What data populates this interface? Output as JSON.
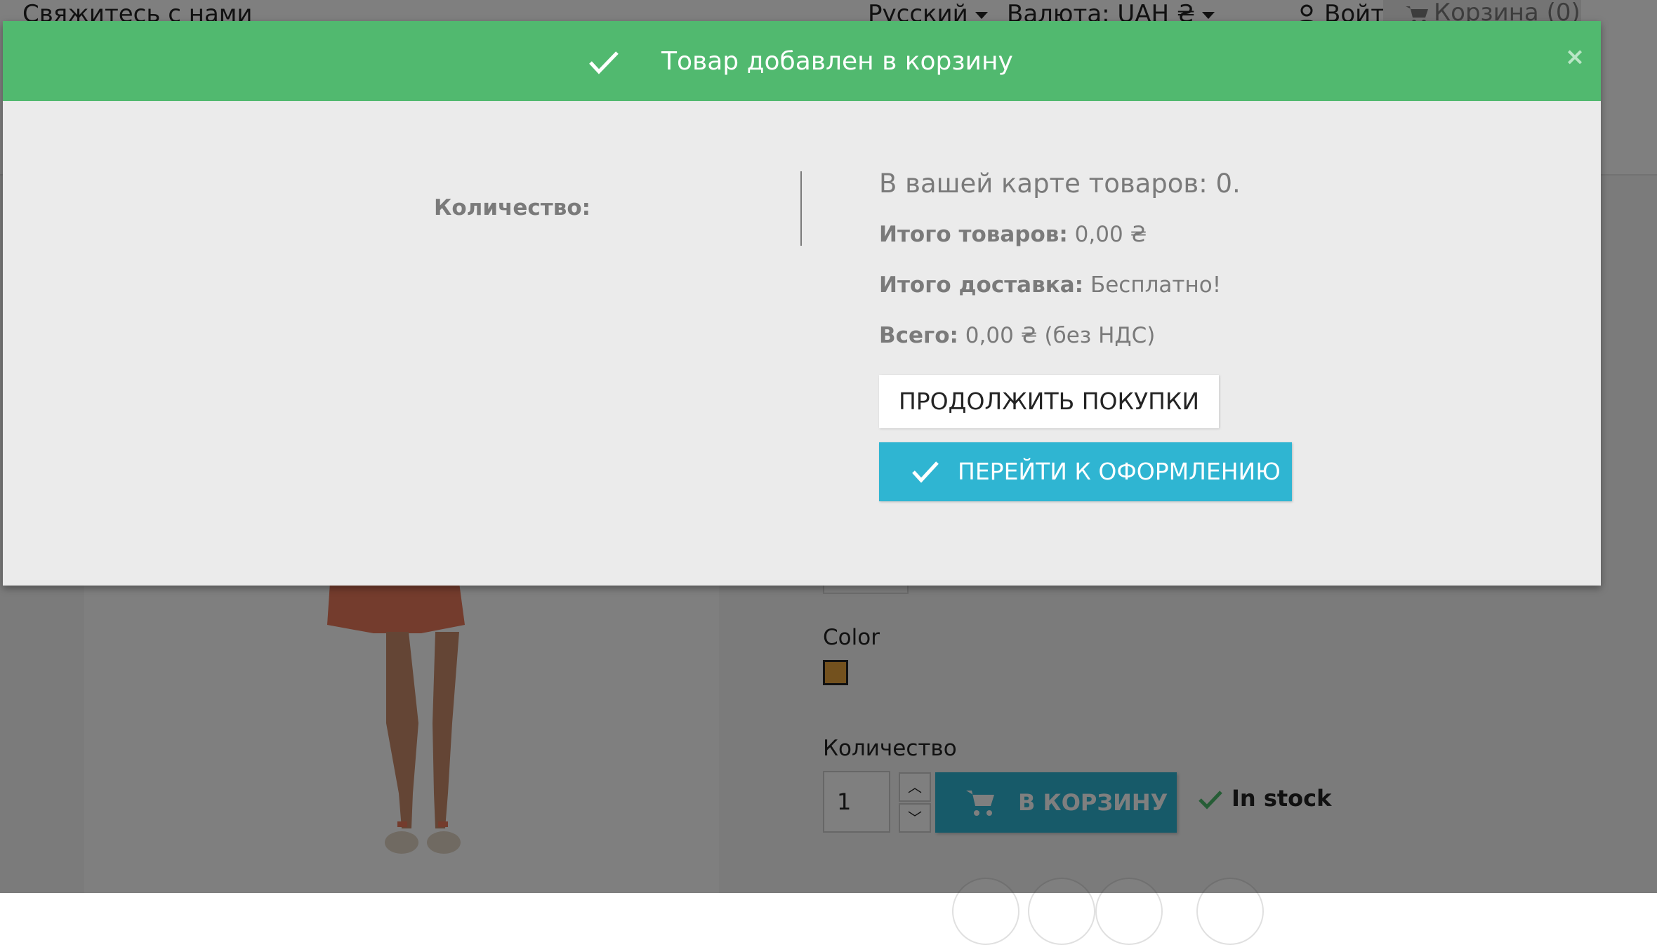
{
  "topbar": {
    "contact": "Свяжитесь с нами",
    "language": "Русский",
    "currency": "Валюта: UAH ₴",
    "login": "Войти",
    "cart": "Корзина (0)"
  },
  "product": {
    "color_label": "Color",
    "swatch_color": "#e6a23c",
    "quantity_label": "Количество",
    "quantity_value": "1",
    "add_to_cart": "В КОРЗИНУ",
    "stock_status": "In stock"
  },
  "modal": {
    "title": "Товар добавлен в корзину",
    "close": "×",
    "quantity_label": "Количество:",
    "cart_count_text": "В вашей карте товаров: 0.",
    "subtotal_label": "Итого товаров:",
    "subtotal_value": "0,00 ₴",
    "shipping_label": "Итого доставка:",
    "shipping_value": "Бесплатно!",
    "total_label": "Всего:",
    "total_value": "0,00 ₴ (без НДС)",
    "continue_button": "ПРОДОЛЖИТЬ ПОКУПКИ",
    "checkout_button": "ПЕРЕЙТИ К ОФОРМЛЕНИЮ",
    "header_color": "#51b96f",
    "checkout_color": "#2fb5d2"
  }
}
